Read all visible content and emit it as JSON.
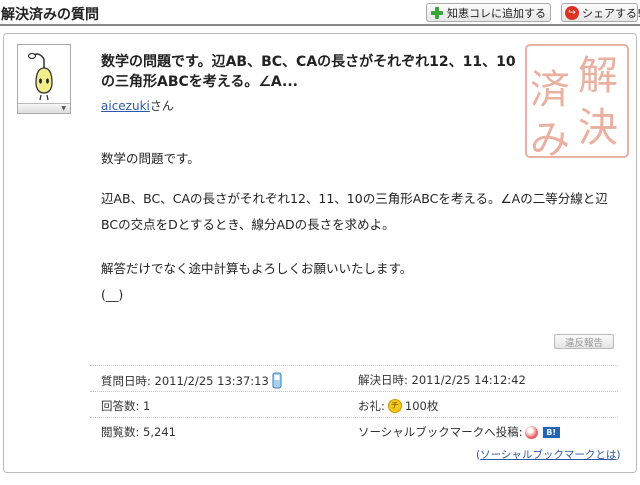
{
  "header": {
    "title": "解決済みの質問",
    "add_button_label": "知恵コレに追加する",
    "share_button_label": "シェアする!"
  },
  "question": {
    "title": "数学の問題です。辺AB、BC、CAの長さがそれぞれ12、11、10の三角形ABCを考える。∠A...",
    "user_name": "aicezuki",
    "user_suffix": "さん",
    "seal_text": [
      "解",
      "決",
      "済",
      "み"
    ],
    "body": {
      "line1": "数学の問題です。",
      "line2": "辺AB、BC、CAの長さがそれぞれ12、11、10の三角形ABCを考える。∠Aの二等分線と辺BCの交点をDとするとき、線分ADの長さを求めよ。",
      "line3": "解答だけでなく途中計算もよろしくお願いいたします。",
      "line4": "(__)"
    },
    "report_label": "違反報告"
  },
  "meta": {
    "asked_label": "質問日時:",
    "asked_value": "2011/2/25 13:37:13",
    "resolved_label": "解決日時:",
    "resolved_value": "2011/2/25 14:12:42",
    "answers_label": "回答数:",
    "answers_value": "1",
    "reward_label": "お礼:",
    "reward_coin": "チ",
    "reward_value": "100枚",
    "views_label": "閲覧数:",
    "views_value": "5,241",
    "social_label": "ソーシャルブックマークへ投稿:",
    "social_badge": "B!",
    "social_link_open": "(",
    "social_link_text": "ソーシャルブックマークとは",
    "social_link_close": ")"
  },
  "colors": {
    "link": "#2e58a8",
    "seal": "#e8a08a",
    "add_icon": "#3aa63a",
    "coin": "#f2c81a"
  }
}
